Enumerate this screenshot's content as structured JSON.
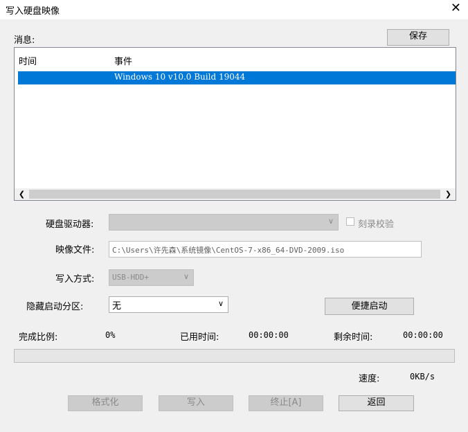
{
  "window": {
    "title": "写入硬盘映像",
    "close_glyph": "✕"
  },
  "messages": {
    "label": "消息:",
    "save_button": "保存",
    "columns": [
      "时间",
      "事件"
    ],
    "rows": [
      {
        "time": "",
        "event": "Windows 10 v10.0 Build 19044",
        "selected": true
      }
    ]
  },
  "form": {
    "drive_label": "硬盘驱动器:",
    "drive_value": "",
    "verify_label": "刻录校验",
    "image_label": "映像文件:",
    "image_path": "C:\\Users\\许先森\\系统镜像\\CentOS-7-x86_64-DVD-2009.iso",
    "method_label": "写入方式:",
    "method_value": "USB-HDD+",
    "hide_label": "隐藏启动分区:",
    "hide_value": "无",
    "easy_boot_button": "便捷启动"
  },
  "status": {
    "progress_label": "完成比例:",
    "progress_value": "0%",
    "progress_fraction": 0,
    "elapsed_label": "已用时间:",
    "elapsed_value": "00:00:00",
    "remaining_label": "剩余时间:",
    "remaining_value": "00:00:00",
    "speed_label": "速度:",
    "speed_value": "0KB/s"
  },
  "buttons": {
    "format": "格式化",
    "write": "写入",
    "stop": "终止[A]",
    "back": "返回"
  }
}
